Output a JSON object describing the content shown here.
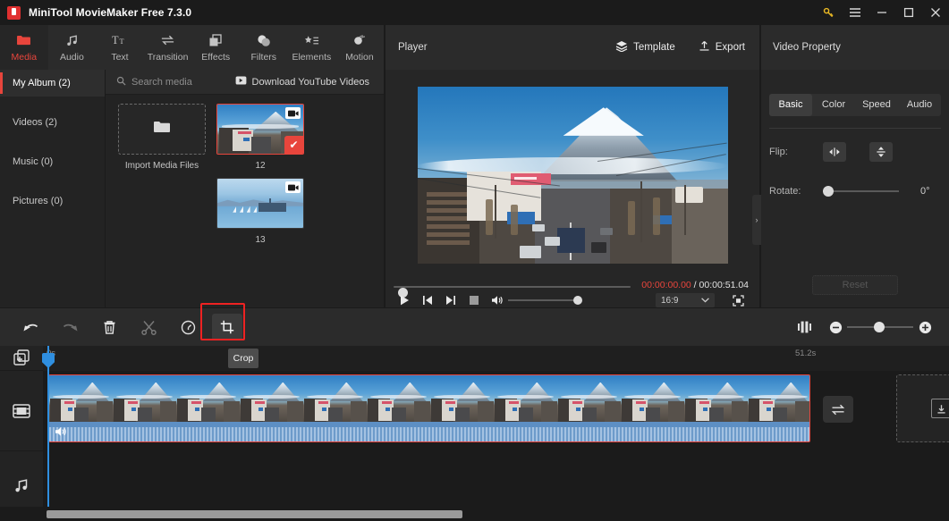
{
  "app": {
    "title": "MiniTool MovieMaker Free 7.3.0",
    "accent_red": "#e8453c",
    "titlebar_icons": [
      {
        "name": "key-icon",
        "glyph": "key"
      },
      {
        "name": "menu-icon",
        "glyph": "hamburger"
      },
      {
        "name": "minimize-icon",
        "glyph": "minimize"
      },
      {
        "name": "maximize-icon",
        "glyph": "maximize"
      },
      {
        "name": "close-icon",
        "glyph": "close"
      }
    ]
  },
  "ribbon": {
    "tabs": [
      {
        "label": "Media",
        "icon": "folder-icon",
        "active": true
      },
      {
        "label": "Audio",
        "icon": "music-note-icon",
        "active": false
      },
      {
        "label": "Text",
        "icon": "text-icon",
        "active": false
      },
      {
        "label": "Transition",
        "icon": "transition-arrows-icon",
        "active": false
      },
      {
        "label": "Effects",
        "icon": "layers-square-icon",
        "active": false
      },
      {
        "label": "Filters",
        "icon": "circles-icon",
        "active": false
      },
      {
        "label": "Elements",
        "icon": "star-list-icon",
        "active": false
      },
      {
        "label": "Motion",
        "icon": "motion-circle-icon",
        "active": false
      }
    ]
  },
  "media_panel": {
    "albums": [
      {
        "label": "My Album (2)",
        "active": true
      },
      {
        "label": "Videos (2)",
        "active": false
      },
      {
        "label": "Music (0)",
        "active": false
      },
      {
        "label": "Pictures (0)",
        "active": false
      }
    ],
    "search_placeholder": "Search media",
    "download_label": "Download YouTube Videos",
    "import_label": "Import Media Files",
    "items": [
      {
        "caption": "12",
        "type": "video",
        "selected": true,
        "scene": "fuji"
      },
      {
        "caption": "13",
        "type": "video",
        "selected": false,
        "scene": "lake"
      }
    ]
  },
  "player": {
    "title": "Player",
    "template_label": "Template",
    "export_label": "Export",
    "current_time": "00:00:00.00",
    "separator": " / ",
    "total_time": "00:00:51.04",
    "aspect_ratio": "16:9",
    "controls": [
      {
        "name": "play-button",
        "glyph": "play"
      },
      {
        "name": "previous-frame-button",
        "glyph": "prev"
      },
      {
        "name": "next-frame-button",
        "glyph": "next"
      },
      {
        "name": "stop-button",
        "glyph": "stop"
      },
      {
        "name": "volume-button",
        "glyph": "volume"
      }
    ],
    "volume_percent": 100,
    "seek_percent": 0
  },
  "property_panel": {
    "title": "Video Property",
    "tabs": [
      {
        "label": "Basic",
        "active": true
      },
      {
        "label": "Color",
        "active": false
      },
      {
        "label": "Speed",
        "active": false
      },
      {
        "label": "Audio",
        "active": false
      }
    ],
    "flip_label": "Flip:",
    "flip_horizontal_icon": "flip-horizontal-icon",
    "flip_vertical_icon": "flip-vertical-icon",
    "rotate_label": "Rotate:",
    "rotate_value": "0°",
    "rotate_percent": 0,
    "reset_label": "Reset",
    "collapse_glyph": "›"
  },
  "toolbar": {
    "buttons": [
      {
        "name": "undo-button",
        "label": "Undo",
        "enabled": true
      },
      {
        "name": "redo-button",
        "label": "Redo",
        "enabled": false
      },
      {
        "name": "delete-button",
        "label": "Delete",
        "enabled": true
      },
      {
        "name": "split-button",
        "label": "Split",
        "enabled": false
      },
      {
        "name": "speed-button",
        "label": "Speed",
        "enabled": true
      },
      {
        "name": "crop-button",
        "label": "Crop",
        "enabled": true,
        "highlighted": true
      }
    ],
    "tooltip": "Crop",
    "zoom_percent": 42,
    "zoom_out_label": "−",
    "zoom_in_label": "+"
  },
  "timeline": {
    "ruler_start": "0s",
    "ruler_end": "51.2s",
    "tracks": [
      {
        "name": "add-track",
        "icon": "add-media-icon"
      },
      {
        "name": "video-track",
        "icon": "film-icon"
      },
      {
        "name": "audio-track",
        "icon": "music-icon"
      }
    ],
    "clip": {
      "selected": true,
      "has_audio": true,
      "scene": "fuji"
    },
    "swap_icon": "swap-arrows-icon",
    "dropzone_icon": "import-down-icon"
  }
}
